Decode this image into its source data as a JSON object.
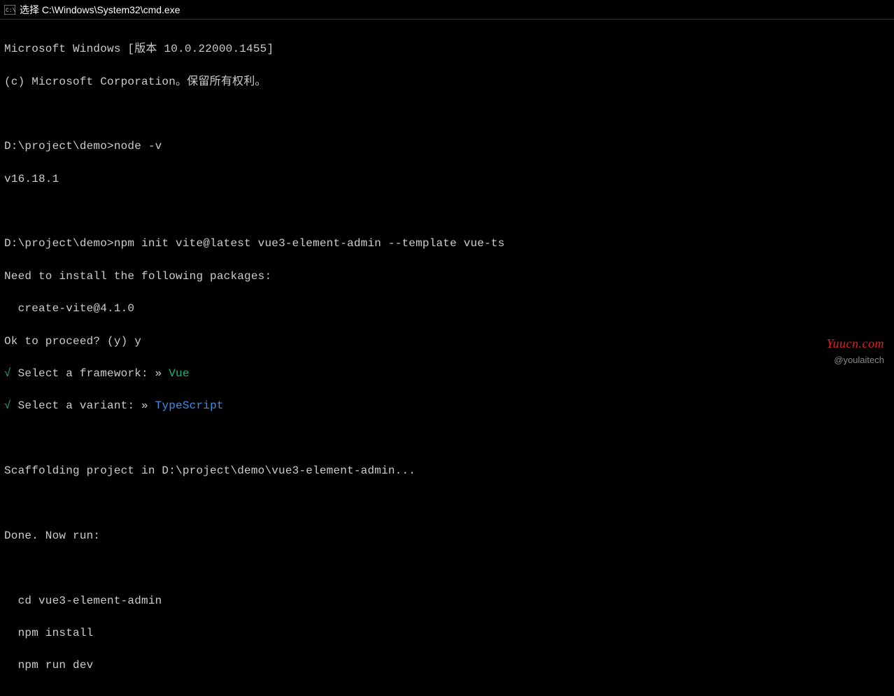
{
  "titlebar": {
    "title": "选择 C:\\Windows\\System32\\cmd.exe"
  },
  "terminal": {
    "banner_line1": "Microsoft Windows [版本 10.0.22000.1455]",
    "banner_line2": "(c) Microsoft Corporation。保留所有权利。",
    "prompt1_path": "D:\\project\\demo>",
    "prompt1_cmd": "node -v",
    "node_version": "v16.18.1",
    "prompt2_path": "D:\\project\\demo>",
    "prompt2_cmd": "npm init vite@latest vue3-element-admin --template vue-ts",
    "install_msg": "Need to install the following packages:",
    "install_pkg": "  create-vite@4.1.0",
    "proceed_prompt": "Ok to proceed? (y) y",
    "check_mark": "√",
    "select_framework_label": " Select a framework: » ",
    "select_framework_value": "Vue",
    "select_variant_label": " Select a variant: » ",
    "select_variant_value": "TypeScript",
    "scaffold_msg": "Scaffolding project in D:\\project\\demo\\vue3-element-admin...",
    "done_msg": "Done. Now run:",
    "run_cd": "  cd vue3-element-admin",
    "run_install": "  npm install",
    "run_dev": "  npm run dev"
  },
  "watermark": {
    "top": "Yuucn.com",
    "bottom": "@youlaitech"
  }
}
